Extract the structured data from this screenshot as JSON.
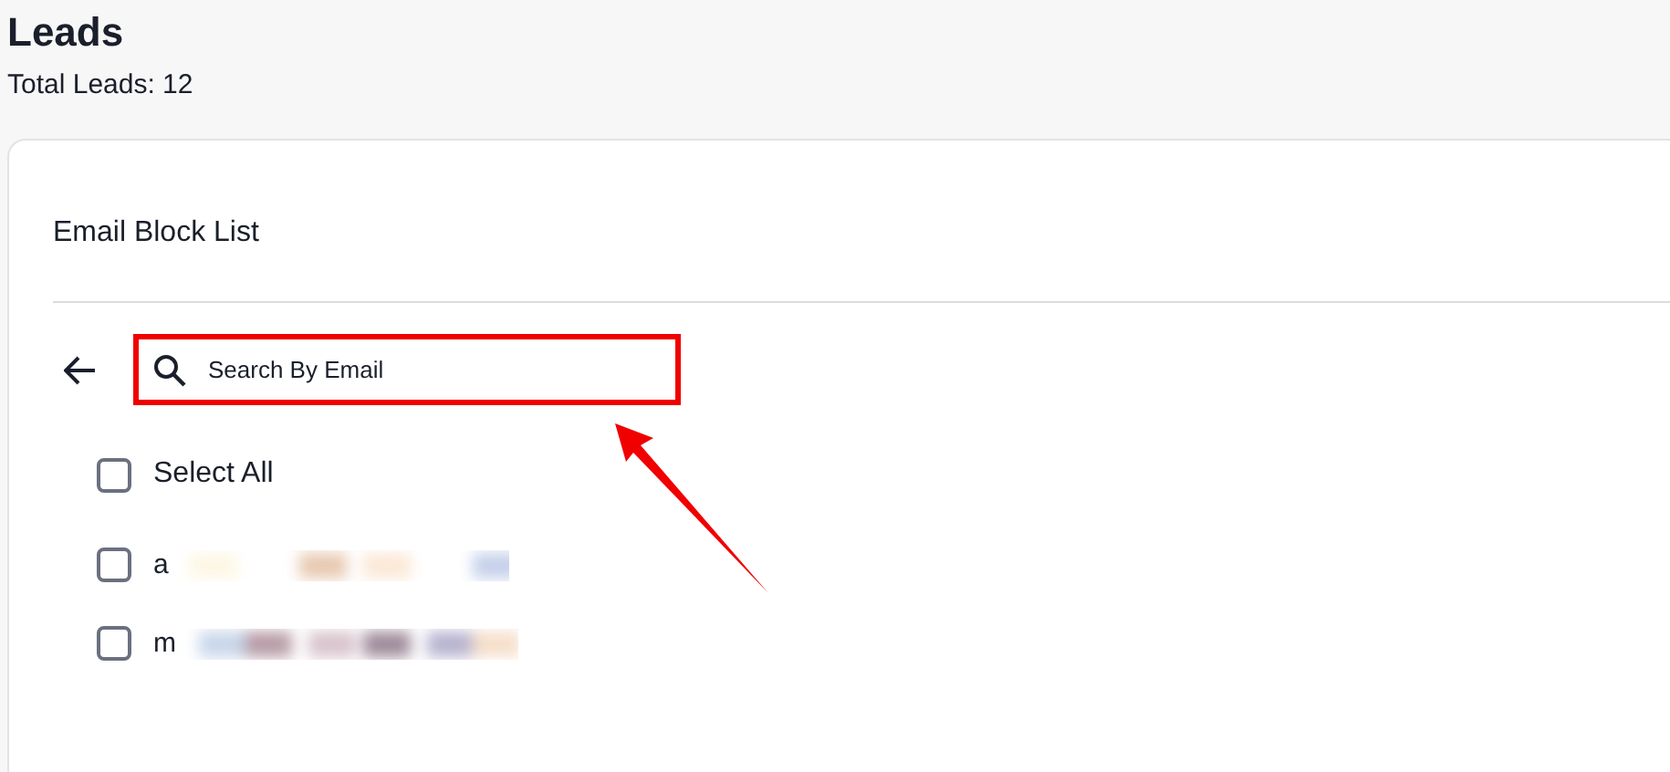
{
  "header": {
    "title": "Leads",
    "subtitle": "Total Leads: 12"
  },
  "card": {
    "title": "Email Block List"
  },
  "search": {
    "placeholder": "Search By Email",
    "highlighted": true,
    "pointer_arrow": true
  },
  "select_all": {
    "label": "Select All",
    "checked": false
  },
  "emails": [
    {
      "text": "a",
      "checked": false
    },
    {
      "text": "m",
      "checked": false
    }
  ]
}
